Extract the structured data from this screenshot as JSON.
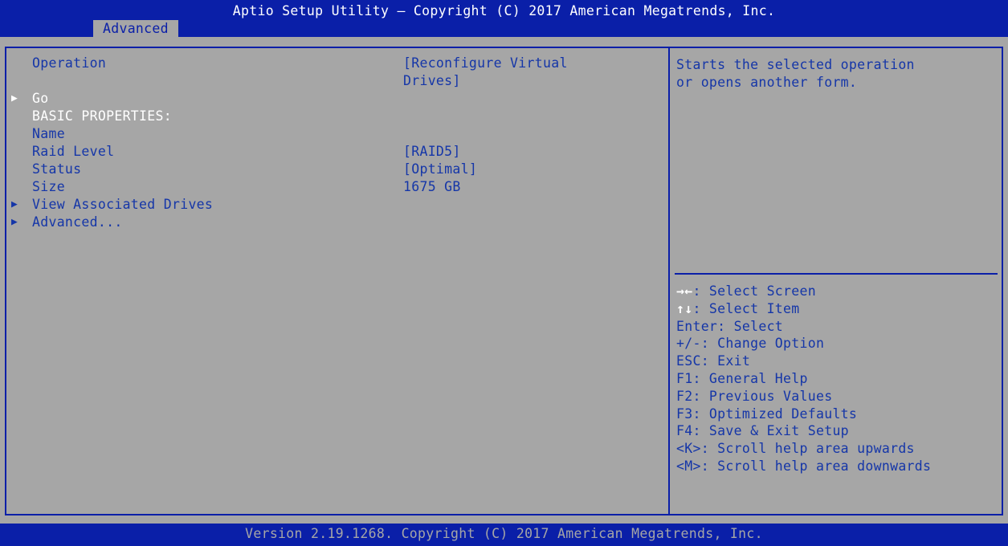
{
  "header": {
    "title": "Aptio Setup Utility – Copyright (C) 2017 American Megatrends, Inc.",
    "tab": "Advanced"
  },
  "main": {
    "operation_label": "Operation",
    "operation_value_line1": "[Reconfigure Virtual",
    "operation_value_line2": "Drives]",
    "go_label": "Go",
    "basic_properties_label": "BASIC PROPERTIES:",
    "name_label": "Name",
    "raid_level_label": "Raid Level",
    "raid_level_value": "[RAID5]",
    "status_label": "Status",
    "status_value": "[Optimal]",
    "size_label": "Size",
    "size_value": "1675 GB",
    "view_drives_label": "View Associated Drives",
    "advanced_label": "Advanced..."
  },
  "help": {
    "text": "Starts the selected operation\nor opens another form.",
    "keys": [
      {
        "glyph": "→←",
        "text": ": Select Screen"
      },
      {
        "glyph": "↑↓",
        "text": ": Select Item"
      },
      {
        "glyph": "",
        "text": "Enter: Select"
      },
      {
        "glyph": "",
        "text": "+/-: Change Option"
      },
      {
        "glyph": "",
        "text": "ESC: Exit"
      },
      {
        "glyph": "",
        "text": "F1: General Help"
      },
      {
        "glyph": "",
        "text": "F2: Previous Values"
      },
      {
        "glyph": "",
        "text": "F3: Optimized Defaults"
      },
      {
        "glyph": "",
        "text": "F4: Save & Exit Setup"
      },
      {
        "glyph": "",
        "text": "<K>: Scroll help area upwards"
      },
      {
        "glyph": "",
        "text": "<M>: Scroll help area downwards"
      }
    ]
  },
  "footer": {
    "version": "Version 2.19.1268. Copyright (C) 2017 American Megatrends, Inc."
  },
  "colors": {
    "bar_blue": "#0a1fa8",
    "background_gray": "#a6a6a6",
    "text_blue": "#1536a8",
    "highlight_white": "#ffffff"
  }
}
